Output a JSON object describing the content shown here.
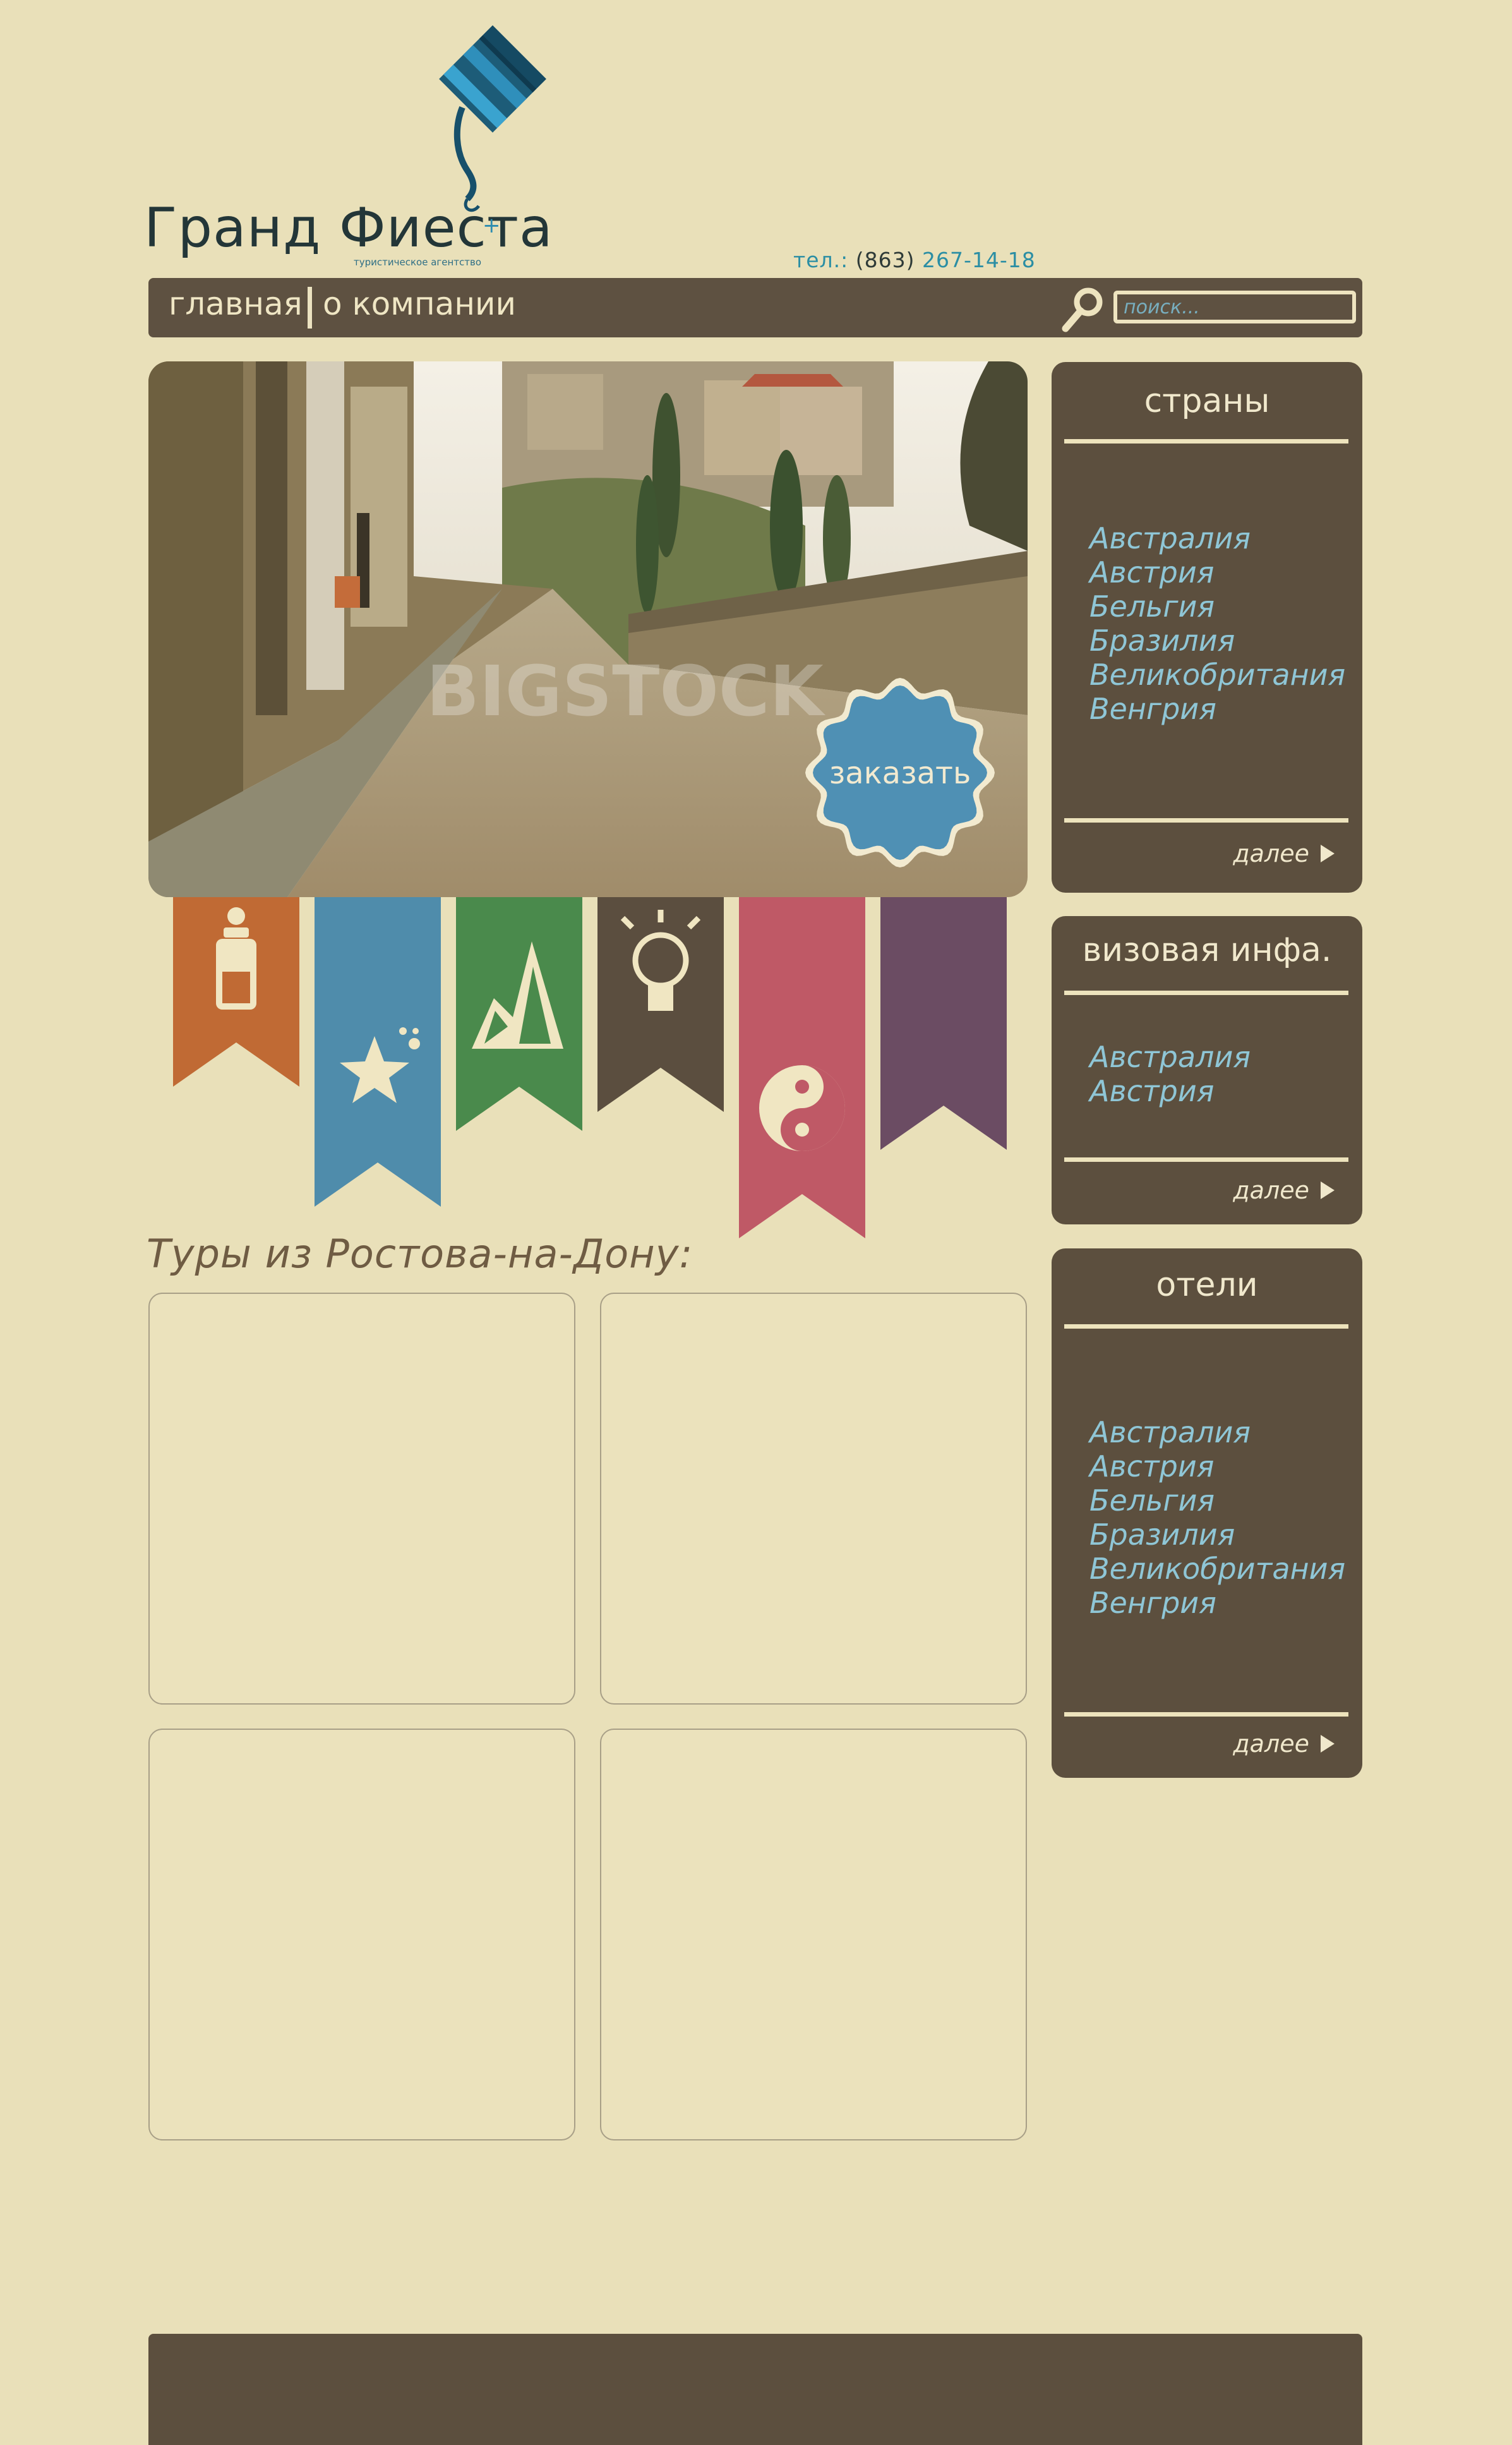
{
  "brand": {
    "name": "Гранд Фиеста",
    "tagline": "туристическое агентство",
    "plus": "+"
  },
  "contact": {
    "label": "тел.:",
    "code": "(863)",
    "number": "267-14-18"
  },
  "nav": {
    "items": [
      {
        "label": "главная"
      },
      {
        "label": "о компании"
      }
    ],
    "search_placeholder": "поиск..."
  },
  "hero": {
    "order_label": "заказать",
    "watermark": "BIGSTOCK"
  },
  "categories": [
    {
      "icon": "baby-bottle-icon",
      "color": "#c06a34"
    },
    {
      "icon": "starfish-icon",
      "color": "#4f8cab"
    },
    {
      "icon": "mountains-icon",
      "color": "#4a8a4c"
    },
    {
      "icon": "lightbulb-icon",
      "color": "#5b4e3f"
    },
    {
      "icon": "yin-yang-icon",
      "color": "#bf5966"
    },
    {
      "icon": "none",
      "color": "#6b4c63"
    }
  ],
  "tours": {
    "title": "Туры из Ростова-на-Дону:"
  },
  "sidebar": {
    "countries": {
      "title": "страны",
      "links": [
        "Австралия",
        "Австрия",
        "Бельгия",
        "Бразилия",
        "Великобритания",
        "Венгрия"
      ],
      "more": "далее"
    },
    "visa": {
      "title": "визовая инфа.",
      "links": [
        "Австралия",
        "Австрия"
      ],
      "more": "далее"
    },
    "hotels": {
      "title": "отели",
      "links": [
        "Австралия",
        "Австрия",
        "Бельгия",
        "Бразилия",
        "Великобритания",
        "Венгрия"
      ],
      "more": "далее"
    }
  },
  "colors": {
    "background": "#e9e0b9",
    "panel": "#5c4f3e",
    "accent": "#2b8ea4",
    "link": "#8fc6d6"
  }
}
